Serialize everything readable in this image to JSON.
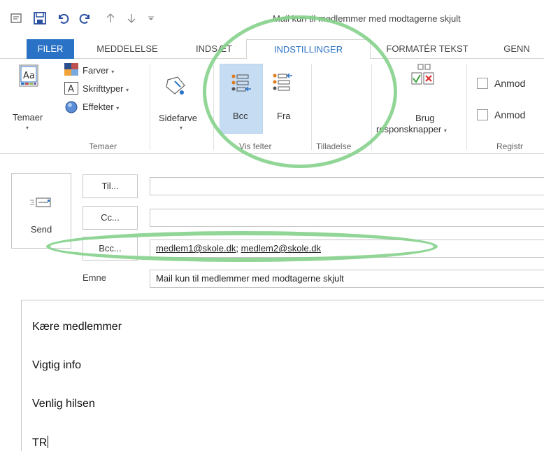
{
  "window": {
    "title": "Mail kun til medlemmer med modtagerne skjult"
  },
  "quick_access": {
    "icons": [
      "mail-icon",
      "save-icon",
      "undo-icon",
      "redo-icon",
      "up-arrow-icon",
      "down-arrow-icon",
      "customize-icon"
    ]
  },
  "tabs": [
    {
      "label": "FILER"
    },
    {
      "label": "MEDDELELSE"
    },
    {
      "label": "INDSÆT"
    },
    {
      "label": "INDSTILLINGER"
    },
    {
      "label": "FORMATÉR TEKST"
    },
    {
      "label": "GENN"
    }
  ],
  "ribbon": {
    "temaer": {
      "button_label": "Temaer",
      "farver": "Farver",
      "skrifttyper": "Skrifttyper",
      "effekter": "Effekter",
      "group_label": "Temaer"
    },
    "sidefarve": {
      "label": "Sidefarve"
    },
    "vis_felter": {
      "bcc": "Bcc",
      "fra": "Fra",
      "group_label": "Vis felter"
    },
    "tilladelse": {
      "group_label": "Tilladelse"
    },
    "brug": {
      "line1": "Brug",
      "line2": "responsknapper"
    },
    "anmod1": "Anmod",
    "anmod2": "Anmod",
    "registr": {
      "group_label": "Registr"
    },
    "accent_color": "#2a72c5",
    "highlight_color": "#85d28c"
  },
  "compose": {
    "send_label": "Send",
    "to_button": "Til...",
    "cc_button": "Cc...",
    "bcc_button": "Bcc...",
    "to_value": "",
    "cc_value": "",
    "bcc_recipient_1": "medlem1@skole.dk",
    "bcc_separator": ";",
    "bcc_recipient_2": "medlem2@skole.dk",
    "subject_label": "Emne",
    "subject_value": "Mail kun til medlemmer med modtagerne skjult",
    "body_lines": [
      "Kære medlemmer",
      "Vigtig info",
      "Venlig hilsen",
      "TR"
    ]
  }
}
